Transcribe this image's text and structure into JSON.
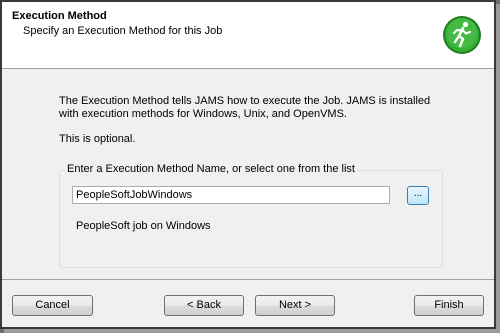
{
  "header": {
    "title": "Execution Method",
    "subtitle": "Specify an Execution Method for this Job",
    "icon": "running-man-icon",
    "icon_color": "#2e9e2e"
  },
  "content": {
    "description": "The Execution Method tells JAMS how to execute the Job.  JAMS is installed with execution methods for Windows, Unix, and OpenVMS.",
    "optional_note": "This is optional.",
    "group_label": "Enter a Execution Method Name, or select one from the list",
    "method_value": "PeopleSoftJobWindows",
    "browse_label": "...",
    "method_description": "PeopleSoft job on Windows"
  },
  "footer": {
    "cancel_label": "Cancel",
    "back_label": "< Back",
    "next_label": "Next >",
    "finish_label": "Finish"
  }
}
